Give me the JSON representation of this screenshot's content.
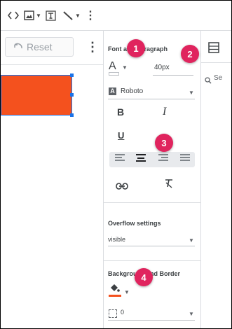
{
  "toolbar": {
    "icons": [
      "code-icon",
      "image-icon",
      "text-box-icon",
      "line-icon",
      "more-vert-icon"
    ]
  },
  "canvas": {
    "reset_label": "Reset",
    "shape_color": "#f4511e",
    "selection_color": "#1a73e8"
  },
  "properties": {
    "font_section_title": "Font and Paragraph",
    "font_color_letter": "A",
    "font_size": "40px",
    "font_family": "Roboto",
    "font_family_letter": "A",
    "bold": "B",
    "italic": "I",
    "underline": "U",
    "link_icon": "⊖",
    "clear_format_icon": "X̶",
    "overflow_title": "Overflow settings",
    "overflow_value": "visible",
    "background_title": "Background and Border",
    "border_width": "0"
  },
  "side_panel": {
    "search_placeholder": "Se"
  },
  "callouts": [
    "1",
    "2",
    "3",
    "4"
  ],
  "colors": {
    "callout": "#e0245e",
    "accent_fill": "#f4511e"
  }
}
